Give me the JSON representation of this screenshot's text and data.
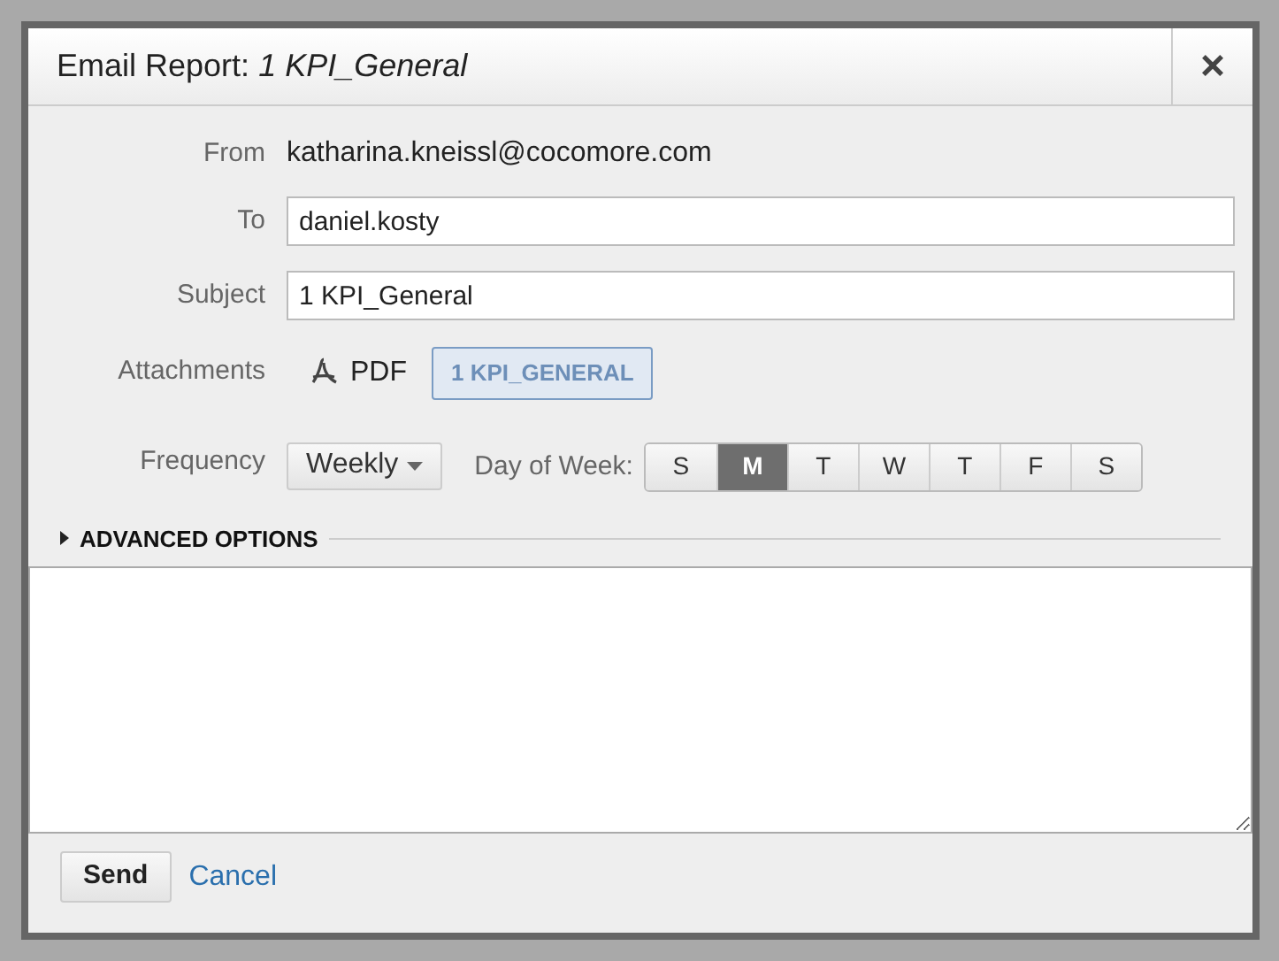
{
  "dialog": {
    "title": "Email Report:",
    "title_report": "1 KPI_General",
    "close": "×"
  },
  "from": {
    "label": "From",
    "value": "katharina.kneissl@cocomore.com"
  },
  "to": {
    "label": "To",
    "value": "daniel.kosty"
  },
  "subject": {
    "label": "Subject",
    "value": "1 KPI_General"
  },
  "attachments": {
    "label": "Attachments",
    "format": "PDF",
    "report": "1 KPI_GENERAL"
  },
  "frequency": {
    "label": "Frequency",
    "value": "Weekly",
    "day_label": "Day of Week:",
    "days": [
      {
        "label": "S",
        "selected": false
      },
      {
        "label": "M",
        "selected": true
      },
      {
        "label": "T",
        "selected": false
      },
      {
        "label": "W",
        "selected": false
      },
      {
        "label": "T",
        "selected": false
      },
      {
        "label": "F",
        "selected": false
      },
      {
        "label": "S",
        "selected": false
      }
    ]
  },
  "advanced": {
    "label": "ADVANCED OPTIONS",
    "expanded": false
  },
  "buttons": {
    "send": "Send",
    "cancel": "Cancel"
  }
}
